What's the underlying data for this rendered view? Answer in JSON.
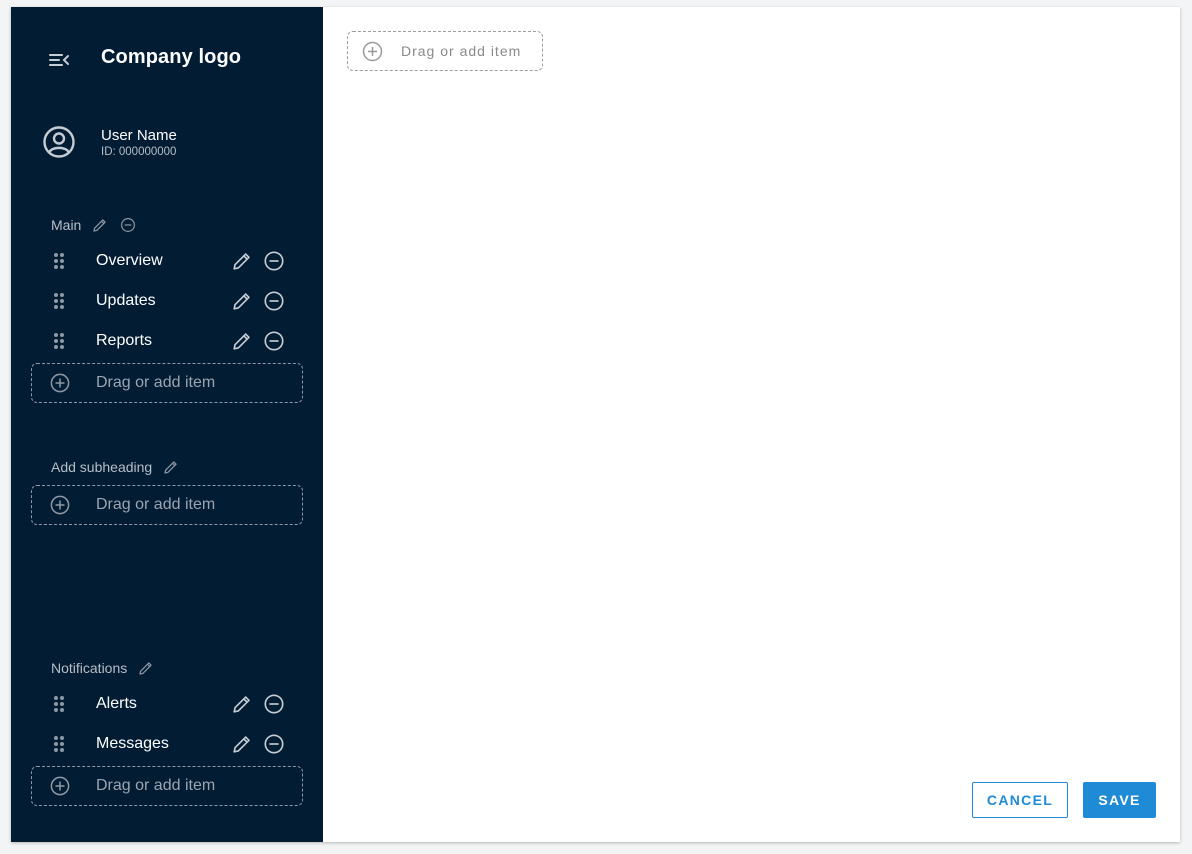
{
  "sidebar": {
    "logo": "Company logo",
    "user": {
      "name": "User Name",
      "id": "ID: 000000000"
    },
    "sections": [
      {
        "heading": "Main",
        "items": [
          {
            "label": "Overview"
          },
          {
            "label": "Updates"
          },
          {
            "label": "Reports"
          }
        ],
        "add_item_label": "Drag or add item"
      },
      {
        "heading": "Add subheading",
        "items": [],
        "add_item_label": "Drag or add item"
      },
      {
        "heading": "Notifications",
        "items": [
          {
            "label": "Alerts"
          },
          {
            "label": "Messages"
          }
        ],
        "add_item_label": "Drag or add item"
      }
    ]
  },
  "main": {
    "add_item_label": "Drag or add item"
  },
  "footer": {
    "cancel_label": "CANCEL",
    "save_label": "SAVE"
  },
  "colors": {
    "sidebar_bg": "#021c33",
    "accent": "#1f8ad6",
    "muted_text": "#b6bec7"
  },
  "icons": {
    "menu": "menu-collapse-icon",
    "avatar": "account-circle-icon",
    "edit": "pencil-icon",
    "remove": "minus-circle-icon",
    "drag": "drag-handle-icon",
    "add": "plus-circle-icon"
  }
}
